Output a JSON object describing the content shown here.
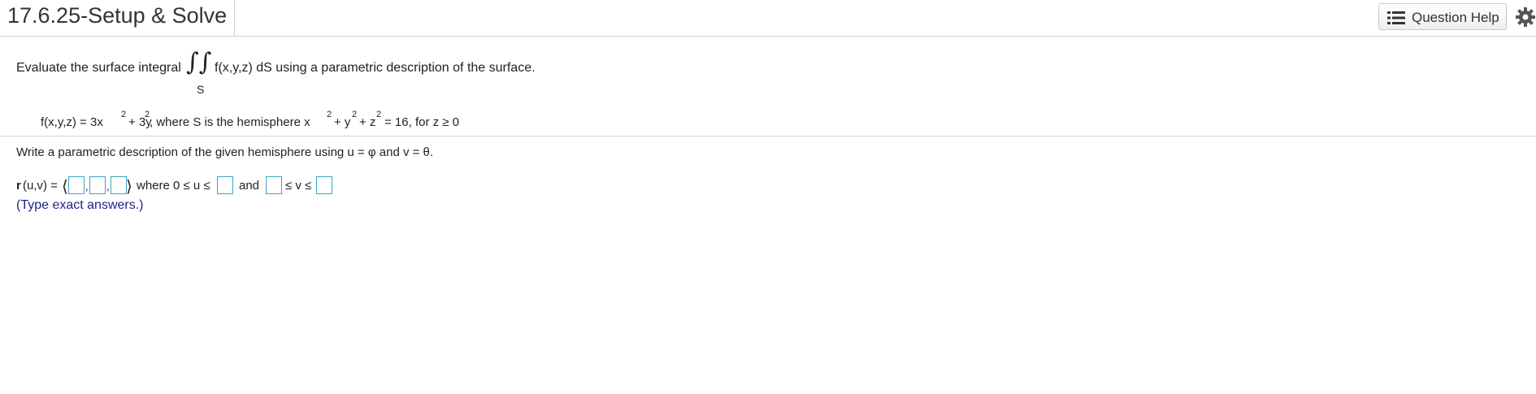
{
  "header": {
    "title": "17.6.25-Setup & Solve",
    "help_button_label": "Question Help",
    "help_icon": "list-icon",
    "settings_icon": "gear-icon"
  },
  "problem": {
    "intro_prefix": "Evaluate the surface integral",
    "integral_symbol": "∫∫",
    "integral_subscript": "S",
    "intro_suffix": "f(x,y,z) dS using a parametric description of the surface.",
    "f_lhs": "f(x,y,z) = 3x",
    "exp_2": "2",
    "f_plus": "+ 3y",
    "hemi_text": ", where S is the hemisphere x",
    "plus_y": "+ y",
    "plus_z": "+ z",
    "eq_text": "= 16, for z ≥ 0"
  },
  "part": {
    "instruction": "Write a parametric description of the given hemisphere using u = φ and v = θ.",
    "r_label": "r",
    "r_args": "(u,v) =",
    "angle_open": "⟨",
    "angle_close": "⟩",
    "comma": ",",
    "where_text": "where 0 ≤ u ≤",
    "and_text": "and",
    "le_v_le": "≤ v ≤",
    "hint": "(Type exact answers.)"
  },
  "colors": {
    "input_border": "#3aa5c7",
    "hint_text": "#1f1f8f"
  }
}
